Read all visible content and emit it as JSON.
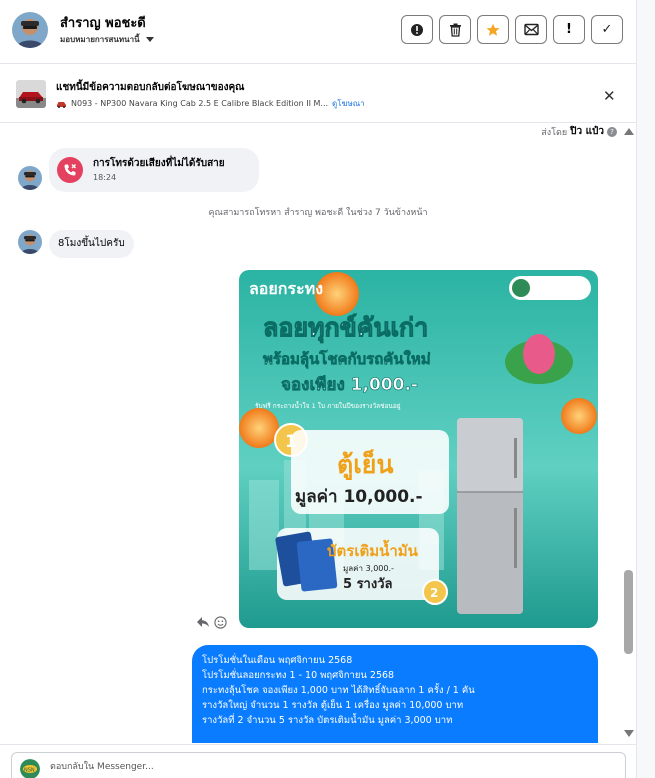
{
  "header": {
    "contact_name": "สำราญ พอชะดี",
    "assign_label": "มอบหมายการสนทนานี้",
    "actions": {
      "spam": "!",
      "delete": "delete",
      "star": "★",
      "mark_unread": "envelope",
      "important": "!",
      "done": "✓"
    }
  },
  "ad_notice": {
    "title": "แชทนี้มีข้อความตอบกลับต่อโฆษณาของคุณ",
    "ad_name": "N093 - NP300 Navara King Cab 2.5 E Calibre Black Edition II M...",
    "view_ad": "ดูโฆษณา"
  },
  "thread": {
    "sent_by_prefix": "ส่งโดย",
    "sent_by_name": "ปิว แป๋ว",
    "missed_call": {
      "title": "การโทรด้วยเสียงที่ไม่ได้รับสาย",
      "time": "18:24"
    },
    "info": "คุณสามารถโทรหา สำราญ พอชะดี ในช่วง 7 วันข้างหน้า",
    "customer_message": "8โมงขึ้นไปครับ",
    "promo_image": {
      "brand": "ลอยกระทง",
      "headline1": "ลอยทุกข์คันเก่า",
      "headline2": "พร้อมลุ้นโชคกับรถคันใหม่",
      "headline3": "จองเพียง 1,000.-",
      "sub": "รับฟรี กระถางน้ำใจ 1 ใบ ภายในปีของรางวัลช่อนอยู่",
      "prize1_label": "ตู้เย็น",
      "prize1_value": "มูลค่า 10,000.-",
      "prize2_label": "บัตรเติมน้ำมัน",
      "prize2_value": "มูลค่า 3,000.-",
      "prize2_count": "5 รางวัล"
    },
    "reply_lines": [
      "โปรโมชั่นในเดือน พฤศจิกายน 2568",
      "โปรโมชั่นลอยกระทง 1 - 10 พฤศจิกายน 2568",
      "กระทงลุ้นโชค จองเพียง 1,000 บาท ได้สิทธิ์จับฉลาก 1 ครั้ง /  1 คัน",
      "รางวัลใหญ่  จำนวน 1 รางวัล   ตู้เย็น 1  เครื่อง  มูลค่า     10,000  บาท",
      "รางวัลที่ 2  จำนวน 5 รางวัล   บัตรเติมน้ำมัน    มูลค่า     3,000   บาท"
    ]
  },
  "composer": {
    "placeholder": "ตอบกลับใน Messenger..."
  },
  "colors": {
    "brand_blue": "#0a7cff",
    "missed_call_red": "#e4405f",
    "star_orange": "#f5a623"
  }
}
